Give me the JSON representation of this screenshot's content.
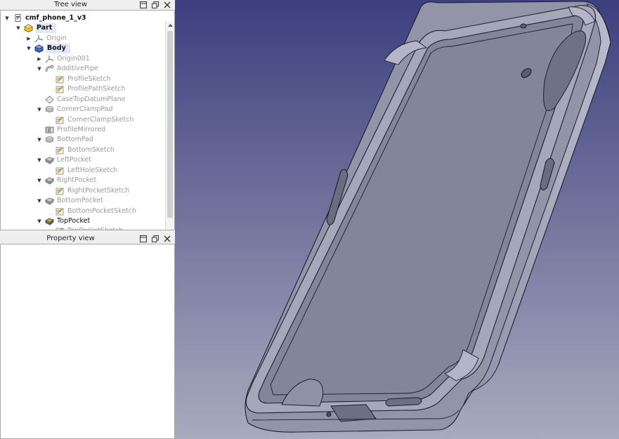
{
  "tree_view": {
    "title": "Tree view",
    "items": [
      {
        "label": "cmf_phone_1_v3",
        "icon": "document-icon",
        "expander": "expanded",
        "style": "bold"
      },
      {
        "label": "Part",
        "icon": "part-icon",
        "expander": "expanded",
        "style": "bold-highlight"
      },
      {
        "label": "Origin",
        "icon": "origin-icon",
        "expander": "collapsed",
        "style": "grey"
      },
      {
        "label": "Body",
        "icon": "body-icon",
        "expander": "expanded",
        "style": "bold-highlight"
      },
      {
        "label": "Origin001",
        "icon": "origin-icon",
        "expander": "collapsed",
        "style": "grey"
      },
      {
        "label": "AdditivePipe",
        "icon": "additive-pipe-icon",
        "expander": "expanded",
        "style": "grey"
      },
      {
        "label": "ProfileSketch",
        "icon": "sketch-icon",
        "expander": "none",
        "style": "grey"
      },
      {
        "label": "ProfilePathSketch",
        "icon": "sketch-icon",
        "expander": "none",
        "style": "grey"
      },
      {
        "label": "CaseTopDatumPlane",
        "icon": "datum-plane-icon",
        "expander": "none",
        "style": "grey"
      },
      {
        "label": "CornerClampPad",
        "icon": "pad-icon",
        "expander": "expanded",
        "style": "grey"
      },
      {
        "label": "CornerClampSketch",
        "icon": "sketch-icon",
        "expander": "none",
        "style": "grey"
      },
      {
        "label": "ProfileMirrored",
        "icon": "mirrored-icon",
        "expander": "none",
        "style": "grey"
      },
      {
        "label": "BottomPad",
        "icon": "pad-icon",
        "expander": "expanded",
        "style": "grey"
      },
      {
        "label": "BottomSketch",
        "icon": "sketch-icon",
        "expander": "none",
        "style": "grey"
      },
      {
        "label": "LeftPocket",
        "icon": "pocket-icon",
        "expander": "expanded",
        "style": "grey"
      },
      {
        "label": "LeftHoleSketch",
        "icon": "sketch-icon",
        "expander": "none",
        "style": "grey"
      },
      {
        "label": "RightPocket",
        "icon": "pocket-icon",
        "expander": "expanded",
        "style": "grey"
      },
      {
        "label": "RightPocketSketch",
        "icon": "sketch-icon",
        "expander": "none",
        "style": "grey"
      },
      {
        "label": "BottomPocket",
        "icon": "pocket-icon",
        "expander": "expanded",
        "style": "grey"
      },
      {
        "label": "BottomPocketSketch",
        "icon": "sketch-icon",
        "expander": "none",
        "style": "grey"
      },
      {
        "label": "TopPocket",
        "icon": "tip-pocket-icon",
        "expander": "expanded",
        "style": "dark"
      },
      {
        "label": "TopPocketSketch",
        "icon": "sketch-icon",
        "expander": "none",
        "style": "grey"
      }
    ]
  },
  "property_view": {
    "title": "Property view"
  },
  "viewport": {
    "background_top": "#3d3f7e",
    "background_bottom": "#a9aabd",
    "model_color": "#9294a8"
  }
}
